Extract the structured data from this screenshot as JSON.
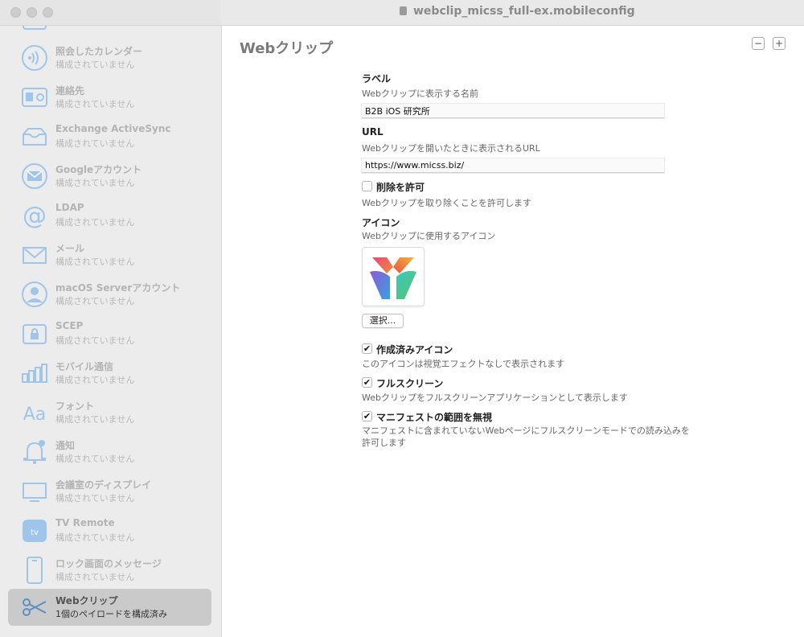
{
  "window": {
    "title": "webclip_micss_full-ex.mobileconfig"
  },
  "sidebar": {
    "items": [
      {
        "title": "",
        "subtitle": "",
        "icon": "calendar-icon"
      },
      {
        "title": "照会したカレンダー",
        "subtitle": "構成されていません",
        "icon": "subscribed-calendar-icon"
      },
      {
        "title": "連絡先",
        "subtitle": "構成されていません",
        "icon": "contacts-icon"
      },
      {
        "title": "Exchange ActiveSync",
        "subtitle": "構成されていません",
        "icon": "exchange-tray-icon"
      },
      {
        "title": "Googleアカウント",
        "subtitle": "構成されていません",
        "icon": "google-mail-icon"
      },
      {
        "title": "LDAP",
        "subtitle": "構成されていません",
        "icon": "at-sign-icon"
      },
      {
        "title": "メール",
        "subtitle": "構成されていません",
        "icon": "mail-envelope-icon"
      },
      {
        "title": "macOS Serverアカウント",
        "subtitle": "構成されていません",
        "icon": "user-account-icon"
      },
      {
        "title": "SCEP",
        "subtitle": "構成されていません",
        "icon": "lock-certificate-icon"
      },
      {
        "title": "モバイル通信",
        "subtitle": "構成されていません",
        "icon": "cellular-bars-icon"
      },
      {
        "title": "フォント",
        "subtitle": "構成されていません",
        "icon": "font-aa-icon"
      },
      {
        "title": "通知",
        "subtitle": "構成されていません",
        "icon": "notification-bell-icon"
      },
      {
        "title": "会議室のディスプレイ",
        "subtitle": "構成されていません",
        "icon": "display-icon"
      },
      {
        "title": "TV Remote",
        "subtitle": "構成されていません",
        "icon": "apple-tv-icon"
      },
      {
        "title": "ロック画面のメッセージ",
        "subtitle": "構成されていません",
        "icon": "iphone-icon"
      },
      {
        "title": "Webクリップ",
        "subtitle": "1個のペイロードを構成済み",
        "icon": "scissors-icon"
      }
    ]
  },
  "main": {
    "title": "Webクリップ",
    "minus_label": "−",
    "plus_label": "+",
    "label_section": {
      "title": "ラベル",
      "description": "Webクリップに表示する名前",
      "value": "B2B iOS 研究所"
    },
    "url_section": {
      "title": "URL",
      "description": "Webクリップを開いたときに表示されるURL",
      "value": "https://www.micss.biz/"
    },
    "removable": {
      "title": "削除を許可",
      "description": "Webクリップを取り除くことを許可します",
      "checked": false
    },
    "icon_section": {
      "title": "アイコン",
      "description": "Webクリップに使用するアイコン",
      "select_label": "選択..."
    },
    "precomposed": {
      "title": "作成済みアイコン",
      "description": "このアイコンは視覚エフェクトなしで表示されます",
      "checked": true
    },
    "fullscreen": {
      "title": "フルスクリーン",
      "description": "Webクリップをフルスクリーンアプリケーションとして表示します",
      "checked": true
    },
    "ignore_manifest": {
      "title": "マニフェストの範囲を無視",
      "description": "マニフェストに含まれていないWebページにフルスクリーンモードでの読み込みを許可します",
      "checked": true
    }
  },
  "colors": {
    "sidebar_icon": "#9fc6ea",
    "selected_row": "#cacaca",
    "checkmark": "#111111"
  }
}
